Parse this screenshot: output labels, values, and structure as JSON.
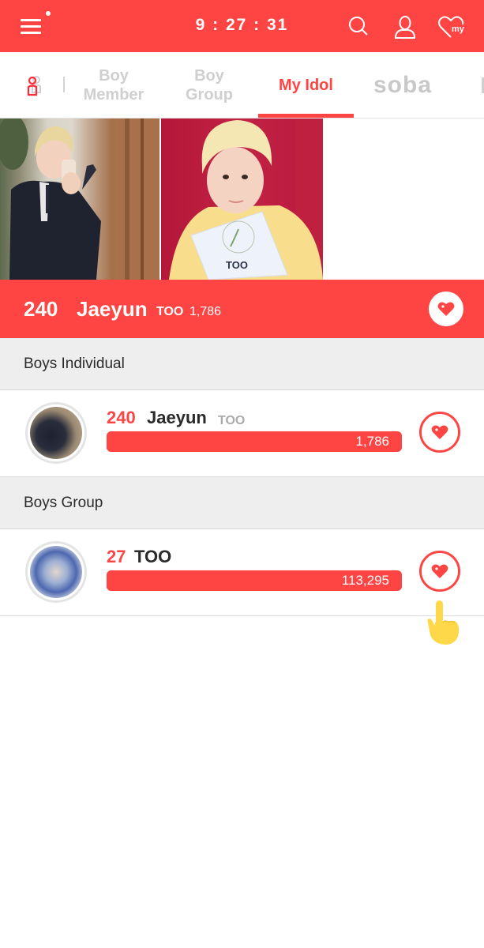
{
  "header": {
    "clock": "9 : 27 : 31",
    "icons": [
      "menu-icon",
      "search-icon",
      "user-icon",
      "my-heart-icon"
    ],
    "my_label": "my"
  },
  "tabs": [
    {
      "label": "",
      "icon": "idol-people-icon",
      "active": false
    },
    {
      "label": "Boy Member",
      "active": false
    },
    {
      "label": "Boy Group",
      "active": false
    },
    {
      "label": "My Idol",
      "active": true
    },
    {
      "label": "soba",
      "icon": "soba-logo",
      "active": false
    }
  ],
  "tab_labels": {
    "boy_member_1": "Boy",
    "boy_member_2": "Member",
    "boy_group_1": "Boy",
    "boy_group_2": "Group",
    "my_idol": "My Idol",
    "soba": "soba"
  },
  "featured": {
    "rank": "240",
    "name": "Jaeyun",
    "group": "TOO",
    "votes": "1,786"
  },
  "sections": [
    {
      "title": "Boys Individual",
      "items": [
        {
          "rank": "240",
          "name": "Jaeyun",
          "group": "TOO",
          "votes": "1,786",
          "progress": 1.0
        }
      ]
    },
    {
      "title": "Boys Group",
      "items": [
        {
          "rank": "27",
          "name": "TOO",
          "group": "",
          "votes": "113,295",
          "progress": 1.0
        }
      ]
    }
  ],
  "colors": {
    "accent": "#ff4444",
    "section_bg": "#eeeeee",
    "inactive_tab": "#cfcfcf",
    "pointer_hand": "#ffd84a"
  }
}
